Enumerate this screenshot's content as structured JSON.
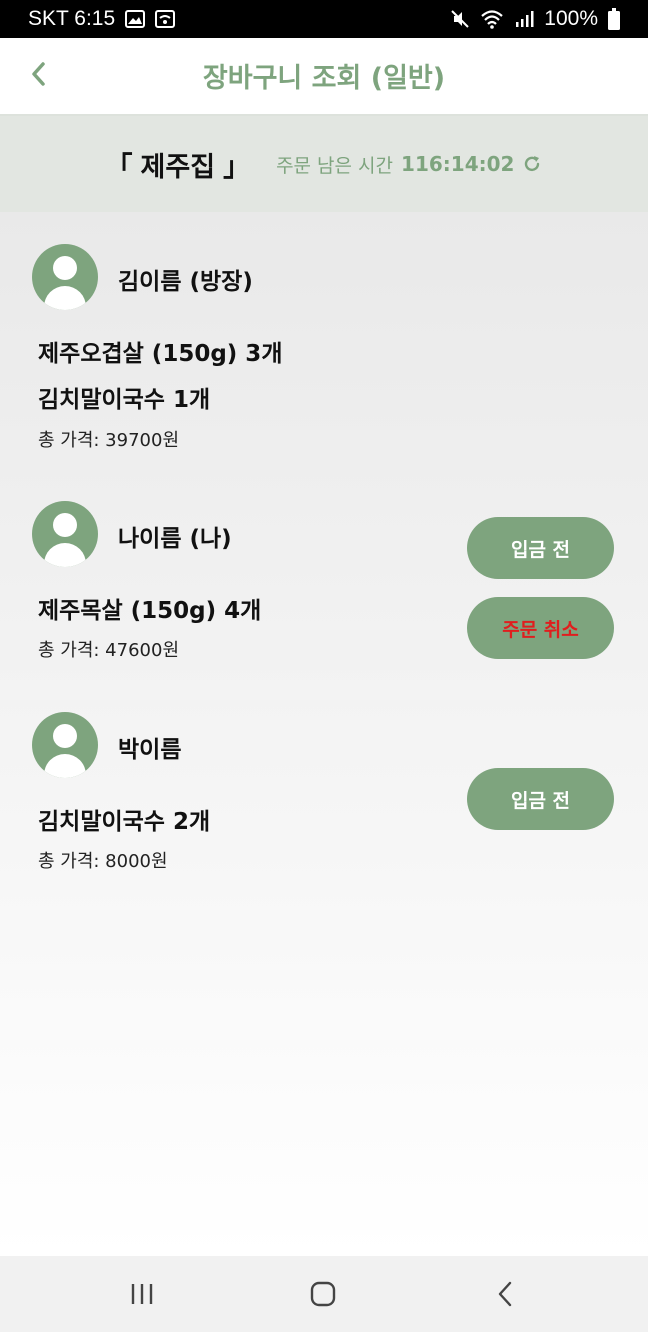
{
  "status_bar": {
    "carrier_time": "SKT 6:15",
    "battery": "100%"
  },
  "app_bar": {
    "title": "장바구니 조회 (일반)",
    "back_icon": "chevron-left-icon"
  },
  "group_header": {
    "bracket_open": "「",
    "store_name": "제주집",
    "bracket_close": "」",
    "timer_label": "주문 남은 시간",
    "timer_value": "116:14:02",
    "refresh_icon": "refresh-icon"
  },
  "members": [
    {
      "name": "김이름 (방장)",
      "items": [
        "제주오겹살 (150g) 3개",
        "김치말이국수 1개"
      ],
      "total": "총 가격: 39700원",
      "buttons": []
    },
    {
      "name": "나이름 (나)",
      "items": [
        "제주목살 (150g) 4개"
      ],
      "total": "총 가격: 47600원",
      "buttons": [
        "입금 전",
        "주문 취소"
      ]
    },
    {
      "name": "박이름",
      "items": [
        "김치말이국수 2개"
      ],
      "total": "총 가격: 8000원",
      "buttons": [
        "입금 전"
      ]
    }
  ],
  "colors": {
    "accent": "#7ea47e",
    "header_bg": "#e2e6e1",
    "cancel_text": "#e01e1e"
  }
}
